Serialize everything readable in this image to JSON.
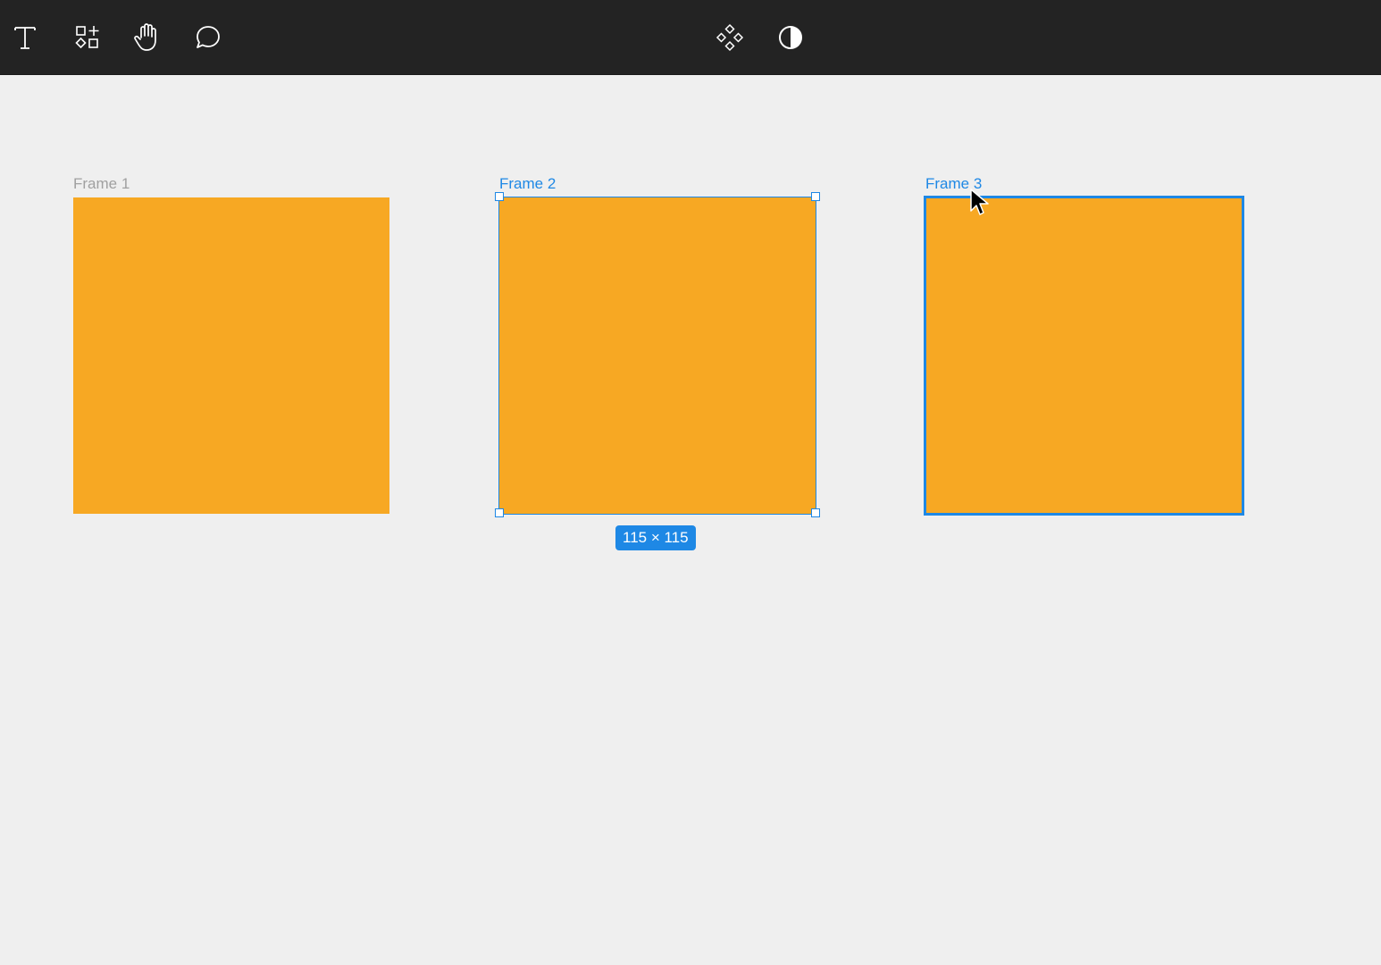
{
  "toolbar": {
    "tools_left": [
      {
        "name": "text-tool",
        "icon": "text-icon"
      },
      {
        "name": "components-tool",
        "icon": "components-add-icon"
      },
      {
        "name": "hand-tool",
        "icon": "hand-icon"
      },
      {
        "name": "comment-tool",
        "icon": "comment-icon"
      }
    ],
    "tools_center": [
      {
        "name": "component-tool",
        "icon": "component-diamonds-icon"
      },
      {
        "name": "theme-toggle",
        "icon": "contrast-icon"
      }
    ]
  },
  "canvas": {
    "frames": [
      {
        "label": "Frame 1",
        "state": "default",
        "fill": "#f7a823"
      },
      {
        "label": "Frame 2",
        "state": "selected",
        "fill": "#f7a823"
      },
      {
        "label": "Frame 3",
        "state": "hovered",
        "fill": "#f7a823"
      }
    ],
    "selection_size": "115 × 115"
  },
  "colors": {
    "toolbar_bg": "#232323",
    "canvas_bg": "#efefef",
    "frame_fill": "#f7a823",
    "selection": "#1e88e5",
    "label_default": "#a0a0a0",
    "label_active": "#1e88e5",
    "icon": "#ffffff"
  }
}
